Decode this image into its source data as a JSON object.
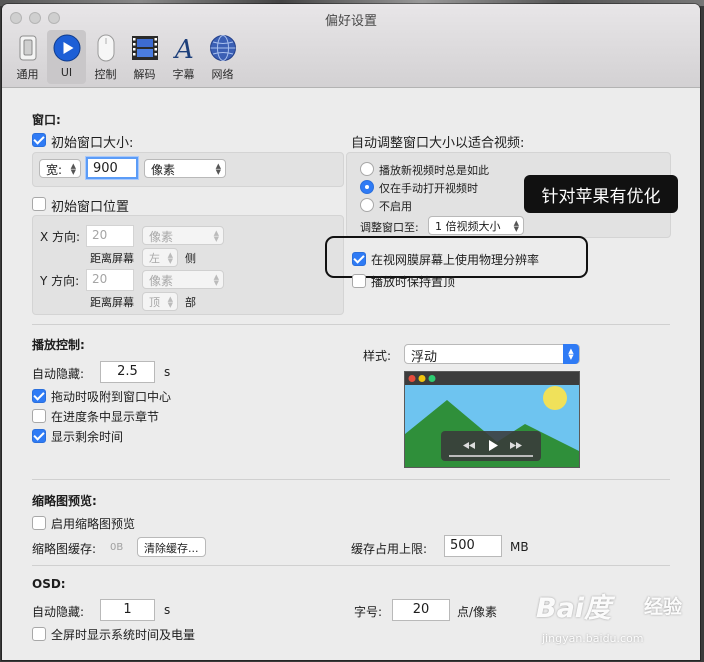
{
  "window": {
    "title": "偏好设置"
  },
  "toolbar": {
    "tabs": [
      {
        "label": "通用",
        "icon": "switch-icon"
      },
      {
        "label": "UI",
        "icon": "play-icon",
        "active": true
      },
      {
        "label": "控制",
        "icon": "mouse-icon"
      },
      {
        "label": "解码",
        "icon": "film-icon"
      },
      {
        "label": "字幕",
        "icon": "letter-a-icon"
      },
      {
        "label": "网络",
        "icon": "globe-icon"
      }
    ]
  },
  "window_section": {
    "heading": "窗口:",
    "initial_size": {
      "label": "初始窗口大小:",
      "checked": true,
      "dimension": "宽:",
      "value": "900",
      "unit": "像素"
    },
    "initial_position": {
      "label": "初始窗口位置",
      "checked": false,
      "x_label": "X 方向:",
      "x_value": "20",
      "x_unit": "像素",
      "x_dist_label": "距离屏幕",
      "x_side": "左",
      "x_suffix": "侧",
      "y_label": "Y 方向:",
      "y_value": "20",
      "y_unit": "像素",
      "y_dist_label": "距离屏幕",
      "y_side": "顶",
      "y_suffix": "部"
    },
    "auto_resize": {
      "heading": "自动调整窗口大小以适合视频:",
      "options": [
        "播放新视频时总是如此",
        "仅在手动打开视频时",
        "不启用"
      ],
      "selected": 1,
      "resize_to_label": "调整窗口至:",
      "resize_to_value": "1 倍视频大小"
    },
    "retina": {
      "label": "在视网膜屏幕上使用物理分辨率",
      "checked": true
    },
    "keep_on_top": {
      "label": "播放时保持置顶",
      "checked": false
    }
  },
  "tooltip": {
    "text": "针对苹果有优化"
  },
  "playback": {
    "heading": "播放控制:",
    "autohide_label": "自动隐藏:",
    "autohide_value": "2.5",
    "autohide_unit": "s",
    "options": [
      {
        "label": "拖动时吸附到窗口中心",
        "checked": true
      },
      {
        "label": "在进度条中显示章节",
        "checked": false
      },
      {
        "label": "显示剩余时间",
        "checked": true
      }
    ],
    "style_label": "样式:",
    "style_value": "浮动"
  },
  "thumbnail": {
    "heading": "缩略图预览:",
    "enable_label": "启用缩略图预览",
    "enable_checked": false,
    "cache_label": "缩略图缓存:",
    "cache_size": "0B",
    "clear_button": "清除缓存...",
    "cache_limit_label": "缓存占用上限:",
    "cache_limit_value": "500",
    "cache_limit_unit": "MB"
  },
  "osd": {
    "heading": "OSD:",
    "autohide_label": "自动隐藏:",
    "autohide_value": "1",
    "autohide_unit": "s",
    "fontsize_label": "字号:",
    "fontsize_value": "20",
    "fontsize_unit": "点/像素",
    "fullscreen_label": "全屏时显示系统时间及电量",
    "fullscreen_checked": false
  },
  "watermark": {
    "logo": "Bai度",
    "name": "经验",
    "url": "jingyan.baidu.com"
  },
  "colors": {
    "accent": "#2f7bf5",
    "window_bg": "#ececec",
    "tooltip_bg": "#111111"
  }
}
